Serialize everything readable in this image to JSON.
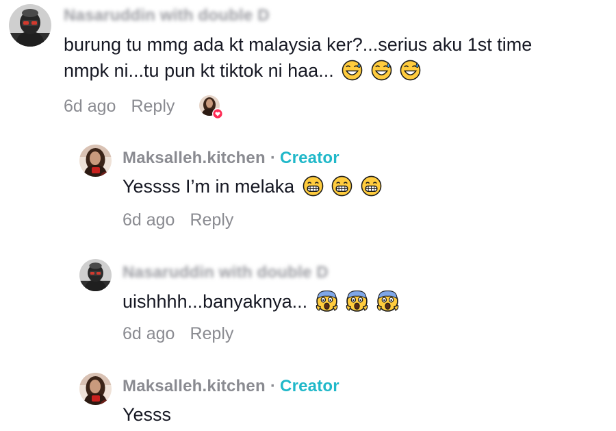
{
  "comments": [
    {
      "username": "Nasaruddin with double D",
      "text": "burung tu mmg ada kt malaysia ker?...serius aku 1st time",
      "text_line2": "nmpk ni...tu pun kt tiktok ni haa...",
      "emoji": [
        "grinning-sweat-emoji",
        "grinning-sweat-emoji",
        "grinning-sweat-emoji"
      ],
      "time": "6d ago",
      "reply": "Reply"
    },
    {
      "username": "Maksalleh.kitchen",
      "separator": "·",
      "badge": "Creator",
      "text": "Yessss I’m in melaka",
      "emoji": [
        "grimacing-emoji",
        "grimacing-emoji",
        "grimacing-emoji"
      ],
      "time": "6d ago",
      "reply": "Reply"
    },
    {
      "username": "Nasaruddin with double D",
      "text": "uishhhh...banyaknya...",
      "emoji": [
        "screaming-emoji",
        "screaming-emoji",
        "screaming-emoji"
      ],
      "time": "6d ago",
      "reply": "Reply"
    },
    {
      "username": "Maksalleh.kitchen",
      "separator": "·",
      "badge": "Creator",
      "text": "Yesss"
    }
  ],
  "colors": {
    "creator": "#20b8c9",
    "meta": "#8a8b91",
    "text": "#161823",
    "like_heart": "#fe2c55"
  }
}
